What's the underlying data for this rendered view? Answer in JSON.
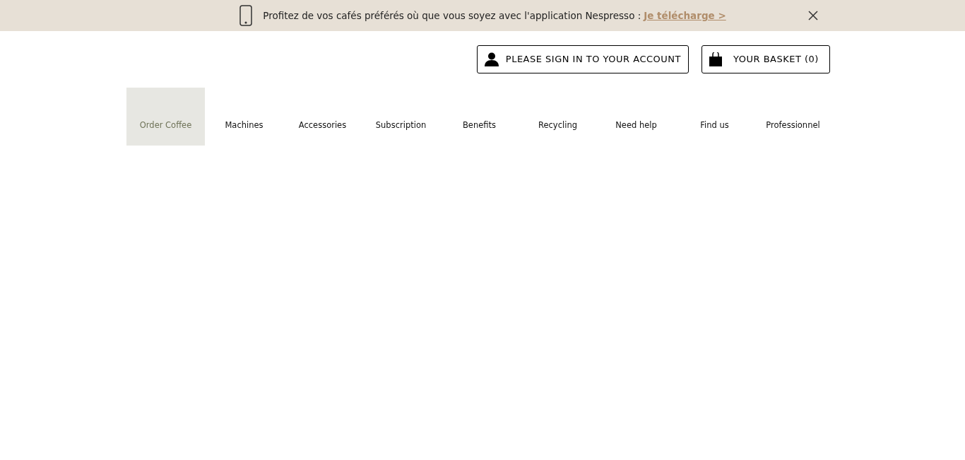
{
  "banner": {
    "text": "Profitez de vos cafés préférés où que vous soyez avec l'application Nespresso :",
    "link": "Je télécharge >"
  },
  "account_button": "PLEASE SIGN IN TO YOUR ACCOUNT",
  "basket_button": "YOUR BASKET (0)",
  "nav": [
    {
      "label": "Order Coffee",
      "selected": true
    },
    {
      "label": "Machines",
      "selected": false
    },
    {
      "label": "Accessories",
      "selected": false
    },
    {
      "label": "Subscription",
      "selected": false
    },
    {
      "label": "Benefits",
      "selected": false
    },
    {
      "label": "Recycling",
      "selected": false
    },
    {
      "label": "Need help",
      "selected": false
    },
    {
      "label": "Find us",
      "selected": false
    },
    {
      "label": "Professionnel",
      "selected": false
    }
  ]
}
